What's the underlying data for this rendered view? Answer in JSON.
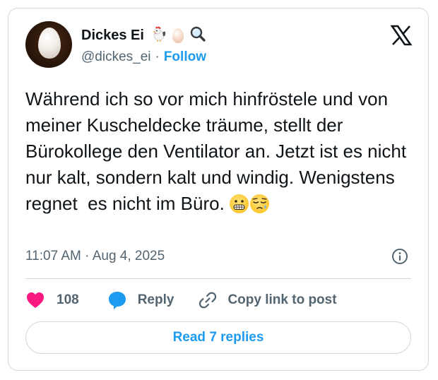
{
  "author": {
    "display_name": "Dickes Ei",
    "name_emojis": [
      "rooster-emoji",
      "egg-emoji",
      "magnifier-emoji"
    ],
    "handle": "@dickes_ei",
    "separator": "·",
    "follow_label": "Follow"
  },
  "tweet": {
    "text": "Während ich so vor mich hinfröstele und von meiner Kuscheldecke träume, stellt der Bürokollege den Ventilator an. Jetzt ist es nicht nur kalt, sondern kalt und windig. Wenigstens regnet  es nicht im Büro. ",
    "trailing_emojis": [
      "grimacing-face-emoji",
      "sleepy-face-emoji"
    ],
    "timestamp": "11:07 AM · Aug 4, 2025"
  },
  "actions": {
    "likes_count": "108",
    "reply_label": "Reply",
    "copy_link_label": "Copy link to post"
  },
  "replies_button": {
    "label": "Read 7 replies"
  },
  "colors": {
    "accent": "#1d9bf0",
    "like": "#f91880",
    "text": "#0f1419",
    "muted": "#536471",
    "border": "#cfd9de"
  }
}
